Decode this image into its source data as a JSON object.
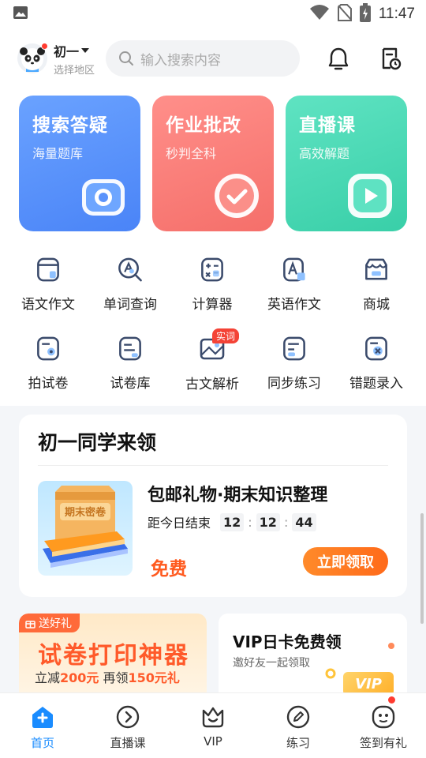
{
  "status_bar": {
    "time": "11:47"
  },
  "header": {
    "grade": "初一",
    "region_hint": "选择地区",
    "search_placeholder": "输入搜索内容"
  },
  "feature_cards": [
    {
      "title": "搜索答疑",
      "subtitle": "海量题库",
      "color": "#5b93fb"
    },
    {
      "title": "作业批改",
      "subtitle": "秒判全科",
      "color": "#fa7f79"
    },
    {
      "title": "直播课",
      "subtitle": "高效解题",
      "color": "#4cdcb8"
    }
  ],
  "tools_row1": [
    {
      "label": "语文作文",
      "icon": "essay-icon"
    },
    {
      "label": "单词查询",
      "icon": "word-lookup-icon"
    },
    {
      "label": "计算器",
      "icon": "calculator-icon"
    },
    {
      "label": "英语作文",
      "icon": "english-essay-icon"
    },
    {
      "label": "商城",
      "icon": "store-icon"
    }
  ],
  "tools_row2": [
    {
      "label": "拍试卷",
      "icon": "photo-paper-icon"
    },
    {
      "label": "试卷库",
      "icon": "paper-library-icon"
    },
    {
      "label": "古文解析",
      "icon": "classical-text-icon",
      "badge": "实词"
    },
    {
      "label": "同步练习",
      "icon": "practice-icon"
    },
    {
      "label": "错题录入",
      "icon": "mistake-entry-icon"
    }
  ],
  "promo": {
    "title": "初一同学来领",
    "thumb_text": "期末密卷",
    "product_name": "包邮礼物·期末知识整理",
    "countdown_label": "距今日结束",
    "countdown": {
      "h": "12",
      "m": "12",
      "s": "44"
    },
    "price": "免费",
    "cta": "立即领取"
  },
  "banner_print": {
    "tag": "送好礼",
    "headline": "试卷打印神器",
    "line_prefix": "立减",
    "amount1": "200元",
    "line_mid": " 再领",
    "amount2": "150元礼"
  },
  "banner_vip": {
    "title": "VIP日卡免费领",
    "subtitle": "邀好友一起领取",
    "card_text": "VIP"
  },
  "tab_bar": [
    {
      "label": "首页",
      "icon": "home-icon",
      "active": true
    },
    {
      "label": "直播课",
      "icon": "live-icon",
      "active": false
    },
    {
      "label": "VIP",
      "icon": "vip-icon",
      "active": false
    },
    {
      "label": "练习",
      "icon": "practice-tab-icon",
      "active": false
    },
    {
      "label": "签到有礼",
      "icon": "checkin-icon",
      "active": false
    }
  ],
  "colors": {
    "accent_blue": "#1a8cff",
    "orange": "#ff6a1a",
    "icon_navy": "#3a4a6b"
  }
}
